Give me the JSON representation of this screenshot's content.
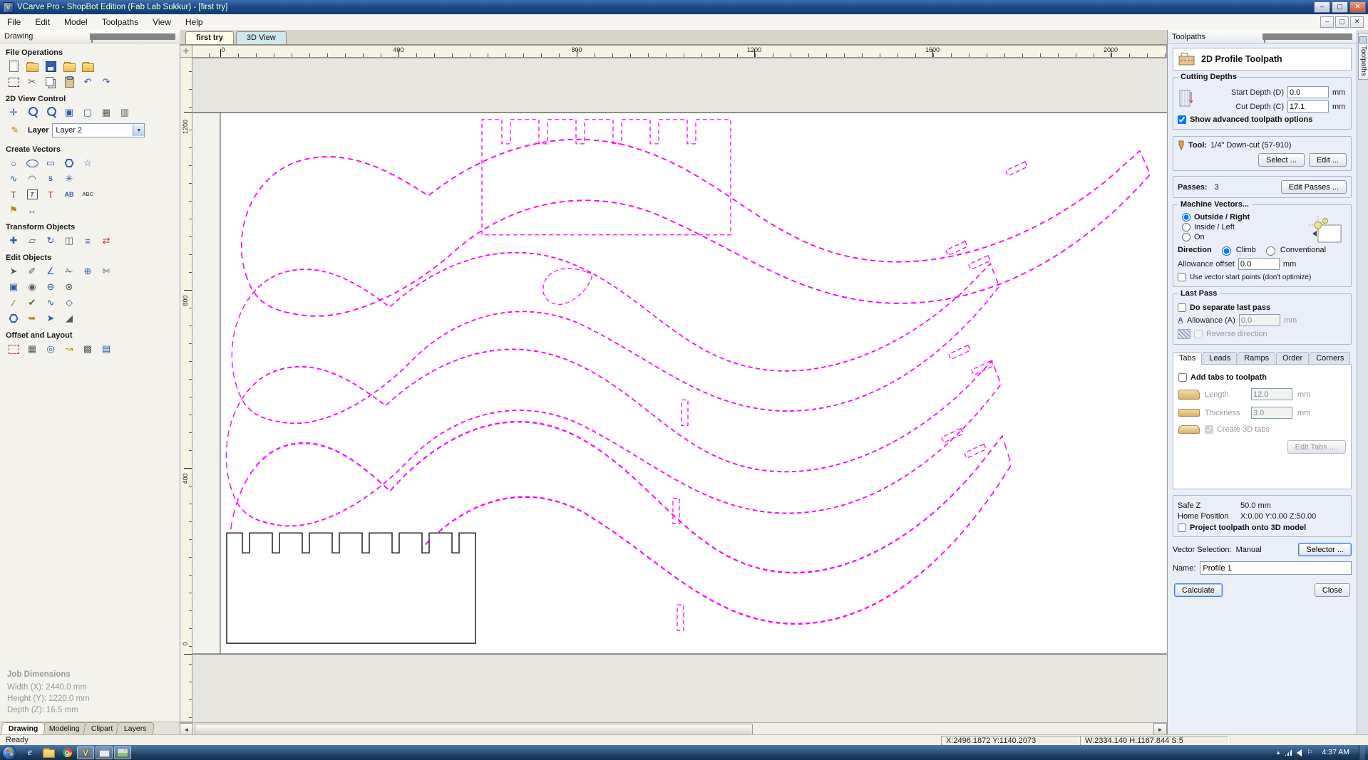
{
  "colors": {
    "vector_magenta": "#ff00ff",
    "outline_black": "#222222",
    "titlebar_blue": "#1d4a8a"
  },
  "titlebar": {
    "title": "VCarve Pro - ShopBot Edition (Fab Lab Sukkur) - [first try]"
  },
  "menubar": {
    "items": [
      "File",
      "Edit",
      "Model",
      "Toolpaths",
      "View",
      "Help"
    ]
  },
  "icons": {
    "min": "–",
    "restore": "▢",
    "close": "✕",
    "cut": "✂",
    "undo": "↶",
    "redo": "↷",
    "pan": "✛",
    "zoom_extents": "▣",
    "zoom_selected": "▢",
    "grid": "▦",
    "guides": "▥",
    "pencil": "✎",
    "dropdown": "▼",
    "circle": "○",
    "rectangle": "▭",
    "star": "☆",
    "polyline": "∿",
    "arc": "◠",
    "spline": "S",
    "spiral": "✳",
    "text": "T",
    "text_spacing": "AB",
    "text_abc": "ABC",
    "flag": "⚑",
    "dimension": "↔",
    "move": "✚",
    "resize": "▱",
    "rotate": "↻",
    "mirror": "◫",
    "align": "≡",
    "distribute": "⇄",
    "select": "➤",
    "node_edit": "✐",
    "measure": "∠",
    "trim": "✁",
    "snap": "⊕",
    "scissors": "✄",
    "group": "▣",
    "weld": "◉",
    "subtract": "⊖",
    "intersect": "⊗",
    "knife": "∕",
    "join": "✔",
    "fit_curves": "∿",
    "close_vector": "◇",
    "extend": "➥",
    "arrow": "➤",
    "chamfer": "◢",
    "array": "▦",
    "circular_array": "◎",
    "copy_along": "↝",
    "nest": "▩",
    "layout": "▤",
    "scroll_left": "◄",
    "scroll_right": "►",
    "corner_cross": "✛",
    "tray_up": "▴",
    "tray_flag": "⚐"
  },
  "drawing_panel": {
    "caption": "Drawing",
    "sections": {
      "file_ops": "File Operations",
      "view_ctrl": "2D View Control",
      "layer_label": "Layer",
      "layer_value": "Layer 2",
      "create": "Create Vectors",
      "transform": "Transform Objects",
      "edit": "Edit Objects",
      "offset": "Offset and Layout"
    },
    "job": {
      "title": "Job Dimensions",
      "width": "Width  (X): 2440.0 mm",
      "height": "Height (Y): 1220.0 mm",
      "depth": "Depth  (Z): 16.5 mm"
    },
    "tabs": [
      "Drawing",
      "Modeling",
      "Clipart",
      "Layers"
    ]
  },
  "document": {
    "tabs": [
      "first try",
      "3D View"
    ],
    "ruler_h": [
      "0",
      "400",
      "800",
      "1200",
      "1600",
      "2000"
    ],
    "ruler_v": [
      "1200",
      "800",
      "400",
      "0"
    ]
  },
  "toolpaths": {
    "caption": "Toolpaths",
    "side_tab": "Toolpaths",
    "header": "2D Profile Toolpath",
    "cutting": {
      "title": "Cutting Depths",
      "start_label": "Start Depth (D)",
      "start_value": "0.0",
      "cut_label": "Cut Depth (C)",
      "cut_value": "17.1",
      "unit": "mm",
      "advanced": "Show advanced toolpath options"
    },
    "tool": {
      "label": "Tool:",
      "value": "1/4\"  Down-cut (57-910)",
      "select_btn": "Select ...",
      "edit_btn": "Edit ..."
    },
    "passes": {
      "label": "Passes:",
      "value": "3",
      "edit_btn": "Edit Passes ..."
    },
    "machine": {
      "title": "Machine Vectors...",
      "opt_outside": "Outside / Right",
      "opt_inside": "Inside / Left",
      "opt_on": "On",
      "direction_label": "Direction",
      "dir_climb": "Climb",
      "dir_conv": "Conventional",
      "allowance_label": "Allowance offset",
      "allowance_value": "0.0",
      "unit": "mm",
      "start_points": "Use vector start points (don't optimize)"
    },
    "last_pass": {
      "title": "Last Pass",
      "do_label": "Do separate last pass",
      "allowance_label": "Allowance (A)",
      "allowance_value": "0.0",
      "unit": "mm",
      "reverse": "Reverse direction"
    },
    "tabs_ctrl": {
      "tabs": [
        "Tabs",
        "Leads",
        "Ramps",
        "Order",
        "Corners"
      ],
      "add_tabs": "Add tabs to toolpath",
      "length_label": "Length",
      "length_value": "12.0",
      "thickness_label": "Thickness",
      "thickness_value": "3.0",
      "unit": "mm",
      "create_3d": "Create 3D tabs",
      "edit_btn": "Edit Tabs ...."
    },
    "footer": {
      "safe_z_label": "Safe Z",
      "safe_z_value": "50.0 mm",
      "home_label": "Home Position",
      "home_value": "X:0.00 Y:0.00 Z:50.00",
      "project": "Project toolpath onto 3D model",
      "vector_sel_label": "Vector Selection:",
      "vector_sel_value": "Manual",
      "selector_btn": "Selector ...",
      "name_label": "Name:",
      "name_value": "Profile 1",
      "calculate_btn": "Calculate",
      "close_btn": "Close"
    }
  },
  "statusbar": {
    "ready": "Ready",
    "coords": "X:2496.1872 Y:1140.2073",
    "size": "W:2334.140 H:1167.844 S:5"
  },
  "taskbar": {
    "time": "4:37 AM"
  }
}
